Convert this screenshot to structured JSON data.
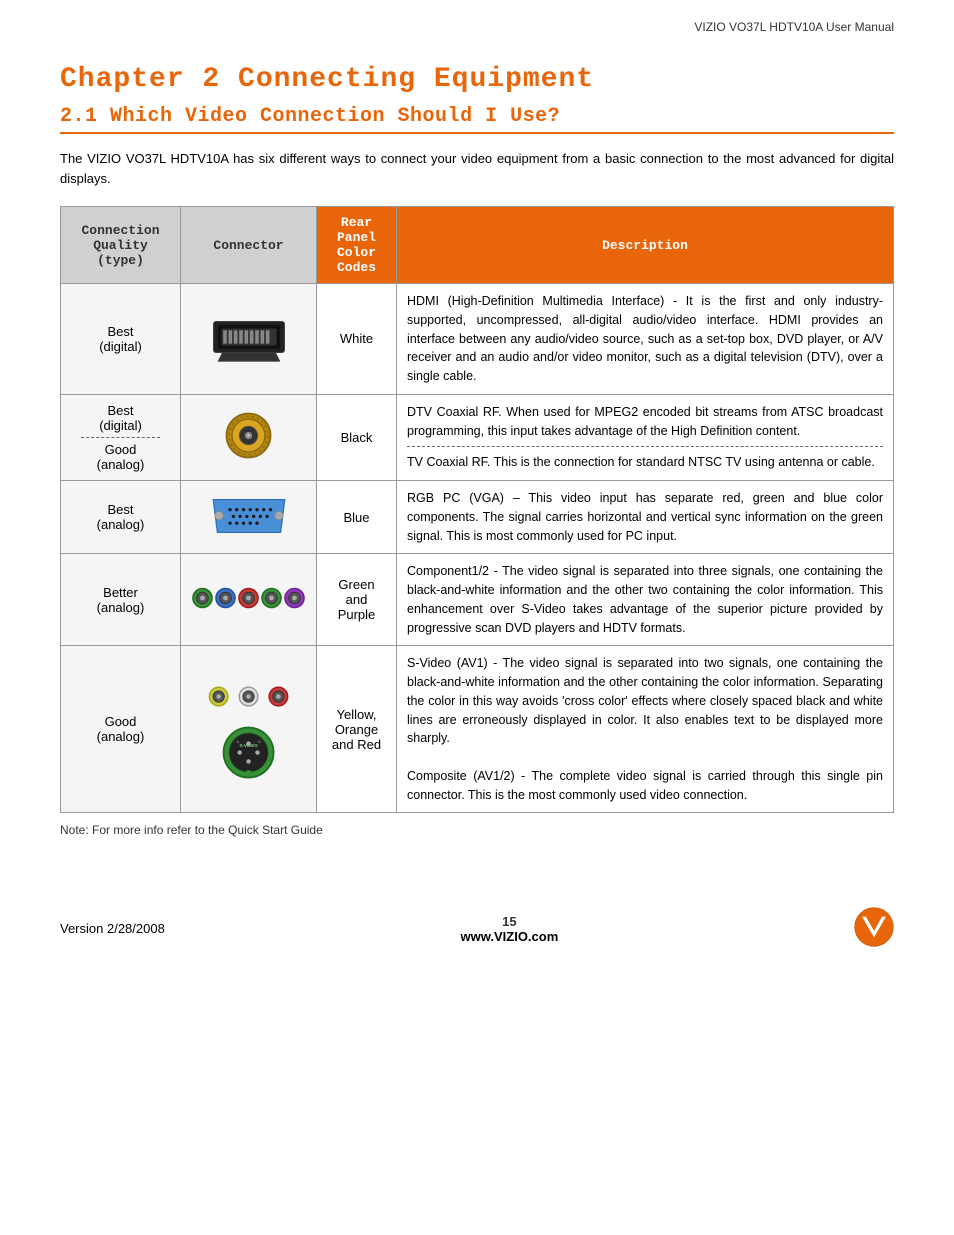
{
  "header": {
    "title": "VIZIO VO37L HDTV10A User Manual"
  },
  "chapter": {
    "title": "Chapter 2  Connecting Equipment",
    "section": "2.1 Which Video Connection Should I Use?",
    "intro": "The VIZIO VO37L HDTV10A has six different ways to connect your video equipment from a basic connection to the most advanced for digital displays."
  },
  "table": {
    "headers": {
      "quality": "Connection Quality (type)",
      "connector": "Connector",
      "color_codes": "Rear Panel Color Codes",
      "description": "Description"
    },
    "rows": [
      {
        "quality": [
          "Best (digital)"
        ],
        "color": "White",
        "description": "HDMI (High-Definition Multimedia Interface) - It is the first and only industry-supported, uncompressed, all-digital audio/video interface. HDMI provides an interface between any audio/video source, such as a set-top box, DVD player, or A/V receiver and an audio and/or video monitor, such as a digital television (DTV), over a single cable.",
        "connector_type": "hdmi"
      },
      {
        "quality": [
          "Best (digital)",
          "Good (analog)"
        ],
        "color": "Black",
        "description_top": "DTV Coaxial RF.  When used for MPEG2 encoded bit streams from ATSC broadcast programming, this input takes advantage of the High Definition content.",
        "description_bottom": "TV Coaxial RF. This is the connection for standard NTSC TV using antenna or cable.",
        "connector_type": "coaxial"
      },
      {
        "quality": [
          "Best (analog)"
        ],
        "color": "Blue",
        "description": "RGB PC (VGA) – This video input has separate red, green and blue color components.  The signal carries horizontal and vertical sync information on the green signal.  This is most commonly used for PC input.",
        "connector_type": "vga"
      },
      {
        "quality": [
          "Better (analog)"
        ],
        "color": "Green and Purple",
        "description": "Component1/2 - The video signal is separated into three signals, one containing the black-and-white information and the other two containing the color information. This enhancement over S-Video takes advantage of the superior picture provided by progressive scan DVD players and HDTV formats.",
        "connector_type": "component"
      },
      {
        "quality": [
          "Good (analog)"
        ],
        "color": "Yellow, Orange and Red",
        "description_top": "S-Video (AV1) - The video signal is separated into two signals, one containing the black-and-white information and the other containing the color information. Separating the color in this way avoids 'cross color' effects where closely spaced black and white lines are erroneously displayed in color.  It also enables text to be displayed more sharply.",
        "description_bottom": "Composite (AV1/2) - The complete video signal is carried through this single pin connector. This is the most commonly used video connection.",
        "connector_type": "av_svideo"
      }
    ]
  },
  "note": "Note:  For more info refer to the Quick Start Guide",
  "footer": {
    "version": "Version 2/28/2008",
    "page": "15",
    "website": "www.VIZIO.com"
  }
}
